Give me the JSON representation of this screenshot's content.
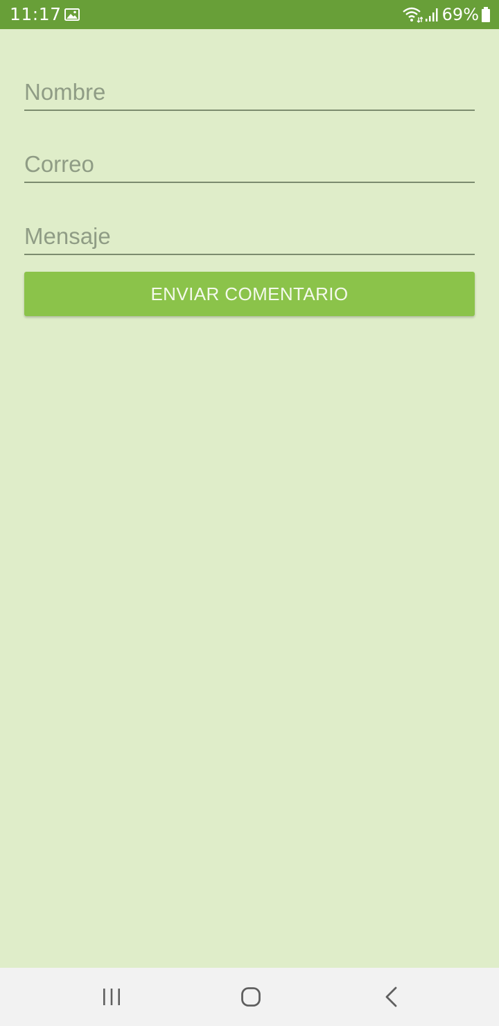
{
  "status_bar": {
    "time": "11:17",
    "battery_percent": "69%",
    "icons": [
      "gallery-icon",
      "wifi-icon",
      "signal-icon",
      "battery-icon"
    ]
  },
  "form": {
    "nombre_placeholder": "Nombre",
    "nombre_value": "",
    "correo_placeholder": "Correo",
    "correo_value": "",
    "mensaje_placeholder": "Mensaje",
    "mensaje_value": "",
    "submit_label": "ENVIAR COMENTARIO"
  },
  "nav_bar": {
    "icons": [
      "recents-icon",
      "home-icon",
      "back-icon"
    ]
  },
  "colors": {
    "status_bar": "#689f38",
    "background": "#dfedc9",
    "button": "#8bc34a",
    "nav_bar": "#f2f2f2"
  }
}
